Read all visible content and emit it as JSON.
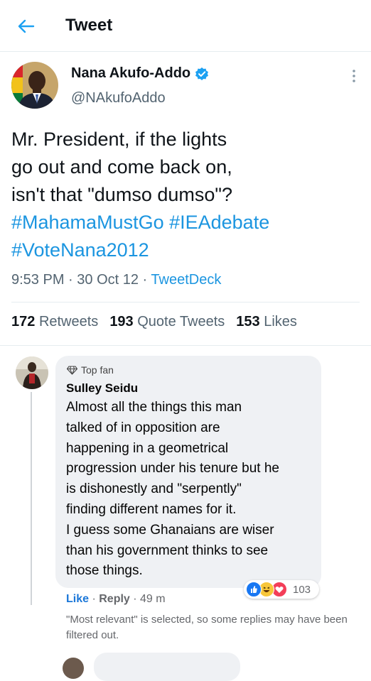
{
  "header": {
    "back_icon": "back-arrow-icon",
    "title": "Tweet"
  },
  "tweet": {
    "author_name": "Nana Akufo-Addo",
    "author_handle": "@NAkufoAddo",
    "verified_icon": "verified-badge-icon",
    "more_icon": "more-vertical-icon",
    "text_lines": [
      "Mr. President, if the lights",
      "go out and come back on,",
      "isn't that \"dumso dumso\"?"
    ],
    "hashtags_line1": "#MahamaMustGo #IEAdebate",
    "hashtags_line2": "#VoteNana2012",
    "time": "9:53 PM",
    "date": "30 Oct 12",
    "source": "TweetDeck",
    "stats": {
      "retweets_count": "172",
      "retweets_label": "Retweets",
      "quotes_count": "193",
      "quotes_label": "Quote Tweets",
      "likes_count": "153",
      "likes_label": "Likes"
    },
    "hashtag_color": "#1b95e0"
  },
  "comment": {
    "badge": "Top fan",
    "badge_icon": "diamond-icon",
    "author": "Sulley Seidu",
    "lines": [
      "Almost all the things this man",
      "talked of in opposition are",
      "happening in a geometrical",
      "progression under his tenure but he",
      "is dishonestly and \"serpently\"",
      "finding different names for it.",
      "I guess some Ghanaians are wiser",
      "than his government thinks to see",
      "those things."
    ],
    "reaction_icons": [
      "like-reaction-icon",
      "haha-reaction-icon",
      "love-reaction-icon"
    ],
    "reaction_count": "103",
    "like_label": "Like",
    "reply_label": "Reply",
    "age": "49 m",
    "filter_note": "\"Most relevant\" is selected, so some replies may have been filtered out."
  }
}
